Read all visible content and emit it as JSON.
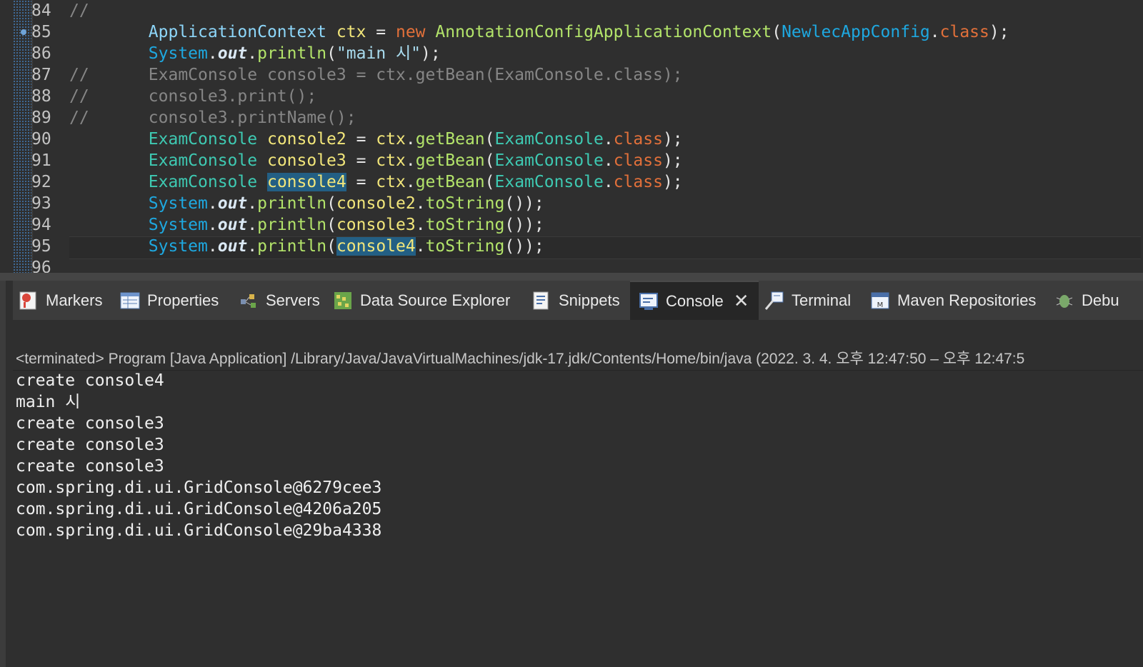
{
  "editor": {
    "lines": [
      {
        "num": "84",
        "tokens": [
          {
            "t": "//",
            "c": "com"
          }
        ]
      },
      {
        "num": "85",
        "breakpoint": true,
        "tokens": [
          {
            "t": "        ",
            "c": "plain"
          },
          {
            "t": "ApplicationContext",
            "c": "def"
          },
          {
            "t": " ",
            "c": "plain"
          },
          {
            "t": "ctx",
            "c": "var"
          },
          {
            "t": " = ",
            "c": "plain"
          },
          {
            "t": "new",
            "c": "kw"
          },
          {
            "t": " ",
            "c": "plain"
          },
          {
            "t": "AnnotationConfigApplicationContext",
            "c": "meth"
          },
          {
            "t": "(",
            "c": "plain"
          },
          {
            "t": "NewlecAppConfig",
            "c": "sys"
          },
          {
            "t": ".",
            "c": "plain"
          },
          {
            "t": "class",
            "c": "kw"
          },
          {
            "t": ");",
            "c": "plain"
          }
        ]
      },
      {
        "num": "86",
        "tokens": [
          {
            "t": "        ",
            "c": "plain"
          },
          {
            "t": "System",
            "c": "sys"
          },
          {
            "t": ".",
            "c": "plain"
          },
          {
            "t": "out",
            "c": "out"
          },
          {
            "t": ".",
            "c": "plain"
          },
          {
            "t": "println",
            "c": "meth"
          },
          {
            "t": "(",
            "c": "plain"
          },
          {
            "t": "\"main 시\"",
            "c": "str"
          },
          {
            "t": ");",
            "c": "plain"
          }
        ]
      },
      {
        "num": "87",
        "tokens": [
          {
            "t": "//      ExamConsole console3 = ctx.getBean(ExamConsole.class);",
            "c": "com"
          }
        ]
      },
      {
        "num": "88",
        "tokens": [
          {
            "t": "//      console3.print();",
            "c": "com"
          }
        ]
      },
      {
        "num": "89",
        "tokens": [
          {
            "t": "//      console3.printName();",
            "c": "com"
          }
        ]
      },
      {
        "num": "90",
        "tokens": [
          {
            "t": "        ",
            "c": "plain"
          },
          {
            "t": "ExamConsole",
            "c": "type"
          },
          {
            "t": " ",
            "c": "plain"
          },
          {
            "t": "console2",
            "c": "var"
          },
          {
            "t": " = ",
            "c": "plain"
          },
          {
            "t": "ctx",
            "c": "var"
          },
          {
            "t": ".",
            "c": "plain"
          },
          {
            "t": "getBean",
            "c": "meth"
          },
          {
            "t": "(",
            "c": "plain"
          },
          {
            "t": "ExamConsole",
            "c": "type"
          },
          {
            "t": ".",
            "c": "plain"
          },
          {
            "t": "class",
            "c": "kw"
          },
          {
            "t": ");",
            "c": "plain"
          }
        ]
      },
      {
        "num": "91",
        "tokens": [
          {
            "t": "        ",
            "c": "plain"
          },
          {
            "t": "ExamConsole",
            "c": "type"
          },
          {
            "t": " ",
            "c": "plain"
          },
          {
            "t": "console3",
            "c": "var"
          },
          {
            "t": " = ",
            "c": "plain"
          },
          {
            "t": "ctx",
            "c": "var"
          },
          {
            "t": ".",
            "c": "plain"
          },
          {
            "t": "getBean",
            "c": "meth"
          },
          {
            "t": "(",
            "c": "plain"
          },
          {
            "t": "ExamConsole",
            "c": "type"
          },
          {
            "t": ".",
            "c": "plain"
          },
          {
            "t": "class",
            "c": "kw"
          },
          {
            "t": ");",
            "c": "plain"
          }
        ]
      },
      {
        "num": "92",
        "tokens": [
          {
            "t": "        ",
            "c": "plain"
          },
          {
            "t": "ExamConsole",
            "c": "type"
          },
          {
            "t": " ",
            "c": "plain"
          },
          {
            "t": "console4",
            "c": "var hl"
          },
          {
            "t": " = ",
            "c": "plain"
          },
          {
            "t": "ctx",
            "c": "var"
          },
          {
            "t": ".",
            "c": "plain"
          },
          {
            "t": "getBean",
            "c": "meth"
          },
          {
            "t": "(",
            "c": "plain"
          },
          {
            "t": "ExamConsole",
            "c": "type"
          },
          {
            "t": ".",
            "c": "plain"
          },
          {
            "t": "class",
            "c": "kw"
          },
          {
            "t": ");",
            "c": "plain"
          }
        ]
      },
      {
        "num": "93",
        "tokens": [
          {
            "t": "        ",
            "c": "plain"
          },
          {
            "t": "System",
            "c": "sys"
          },
          {
            "t": ".",
            "c": "plain"
          },
          {
            "t": "out",
            "c": "out"
          },
          {
            "t": ".",
            "c": "plain"
          },
          {
            "t": "println",
            "c": "meth"
          },
          {
            "t": "(",
            "c": "plain"
          },
          {
            "t": "console2",
            "c": "var"
          },
          {
            "t": ".",
            "c": "plain"
          },
          {
            "t": "toString",
            "c": "meth"
          },
          {
            "t": "());",
            "c": "plain"
          }
        ]
      },
      {
        "num": "94",
        "tokens": [
          {
            "t": "        ",
            "c": "plain"
          },
          {
            "t": "System",
            "c": "sys"
          },
          {
            "t": ".",
            "c": "plain"
          },
          {
            "t": "out",
            "c": "out"
          },
          {
            "t": ".",
            "c": "plain"
          },
          {
            "t": "println",
            "c": "meth"
          },
          {
            "t": "(",
            "c": "plain"
          },
          {
            "t": "console3",
            "c": "var"
          },
          {
            "t": ".",
            "c": "plain"
          },
          {
            "t": "toString",
            "c": "meth"
          },
          {
            "t": "());",
            "c": "plain"
          }
        ]
      },
      {
        "num": "95",
        "current": true,
        "tokens": [
          {
            "t": "        ",
            "c": "plain"
          },
          {
            "t": "System",
            "c": "sys"
          },
          {
            "t": ".",
            "c": "plain"
          },
          {
            "t": "out",
            "c": "out"
          },
          {
            "t": ".",
            "c": "plain"
          },
          {
            "t": "println",
            "c": "meth"
          },
          {
            "t": "(",
            "c": "plain"
          },
          {
            "t": "console4",
            "c": "var hl"
          },
          {
            "t": ".",
            "c": "plain"
          },
          {
            "t": "toString",
            "c": "meth"
          },
          {
            "t": "());",
            "c": "plain"
          }
        ]
      },
      {
        "num": "96",
        "tokens": []
      }
    ]
  },
  "tabs": [
    {
      "label": "Markers",
      "icon": "markers-icon"
    },
    {
      "label": "Properties",
      "icon": "properties-icon"
    },
    {
      "label": "Servers",
      "icon": "servers-icon"
    },
    {
      "label": "Data Source Explorer",
      "icon": "data-source-explorer-icon"
    },
    {
      "label": "Snippets",
      "icon": "snippets-icon"
    },
    {
      "label": "Console",
      "icon": "console-icon",
      "active": true
    },
    {
      "label": "Terminal",
      "icon": "terminal-icon"
    },
    {
      "label": "Maven Repositories",
      "icon": "maven-repositories-icon"
    },
    {
      "label": "Debu",
      "icon": "debug-icon"
    }
  ],
  "console": {
    "status": "<terminated> Program [Java Application] /Library/Java/JavaVirtualMachines/jdk-17.jdk/Contents/Home/bin/java  (2022. 3. 4. 오후 12:47:50 – 오후 12:47:5",
    "output": [
      "create console4",
      "main 시",
      "create console3",
      "create console3",
      "create console3",
      "com.spring.di.ui.GridConsole@6279cee3",
      "com.spring.di.ui.GridConsole@4206a205",
      "com.spring.di.ui.GridConsole@29ba4338"
    ]
  }
}
